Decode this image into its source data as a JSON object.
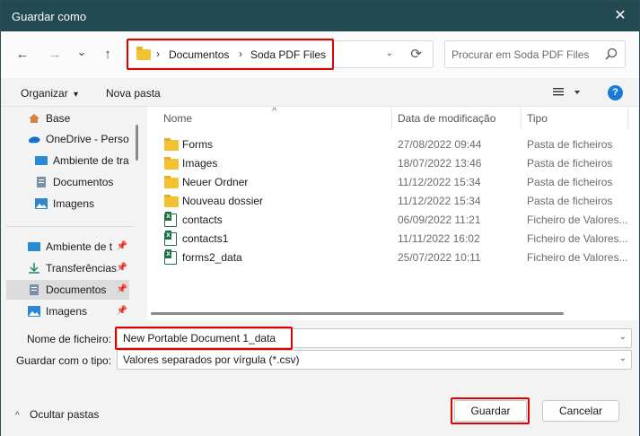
{
  "window": {
    "title": "Guardar como",
    "close_glyph": "✕"
  },
  "nav": {
    "back_glyph": "←",
    "forward_glyph": "→",
    "recent_glyph": "⌄",
    "up_glyph": "↑",
    "address": {
      "separator": "›",
      "crumbs": [
        "Documentos",
        "Soda PDF Files"
      ],
      "dropdown_glyph": "⌄",
      "refresh_glyph": "⟳"
    },
    "search_placeholder": "Procurar em Soda PDF Files"
  },
  "toolbar": {
    "organize_label": "Organizar",
    "organize_chevron": "▾",
    "new_folder_label": "Nova pasta",
    "help_label": "?"
  },
  "sidebar": {
    "items": [
      {
        "label": "Base",
        "icon": "home-icon"
      },
      {
        "label": "OneDrive - Person",
        "icon": "cloud-icon"
      },
      {
        "label": "Ambiente de tra",
        "icon": "desktop-icon"
      },
      {
        "label": "Documentos",
        "icon": "document-icon"
      },
      {
        "label": "Imagens",
        "icon": "image-icon"
      },
      {
        "label": "Ambiente de t",
        "icon": "desktop-icon",
        "pinned": true
      },
      {
        "label": "Transferências",
        "icon": "download-icon",
        "pinned": true
      },
      {
        "label": "Documentos",
        "icon": "document-icon",
        "pinned": true,
        "selected": true
      },
      {
        "label": "Imagens",
        "icon": "image-icon",
        "pinned": true
      }
    ],
    "pin_glyph": "📌"
  },
  "files": {
    "columns": {
      "name": "Nome",
      "date": "Data de modificação",
      "type": "Tipo"
    },
    "sort_glyph": "^",
    "rows": [
      {
        "name": "Forms",
        "date": "27/08/2022 09:44",
        "type": "Pasta de ficheiros",
        "icon": "folder-icon"
      },
      {
        "name": "Images",
        "date": "18/07/2022 13:46",
        "type": "Pasta de ficheiros",
        "icon": "folder-icon"
      },
      {
        "name": "Neuer Ordner",
        "date": "11/12/2022 15:34",
        "type": "Pasta de ficheiros",
        "icon": "folder-icon"
      },
      {
        "name": "Nouveau dossier",
        "date": "11/12/2022 15:34",
        "type": "Pasta de ficheiros",
        "icon": "folder-icon"
      },
      {
        "name": "contacts",
        "date": "06/09/2022 11:21",
        "type": "Ficheiro de Valores...",
        "icon": "excel-icon"
      },
      {
        "name": "contacts1",
        "date": "11/11/2022 16:02",
        "type": "Ficheiro de Valores...",
        "icon": "excel-icon"
      },
      {
        "name": "forms2_data",
        "date": "25/07/2022 10:11",
        "type": "Ficheiro de Valores...",
        "icon": "excel-icon"
      }
    ]
  },
  "form": {
    "filename_label": "Nome de ficheiro:",
    "filename_value": "New Portable Document 1_data",
    "filetype_label": "Guardar com o tipo:",
    "filetype_value": "Valores separados por vírgula (*.csv)",
    "chevron": "⌄"
  },
  "footer": {
    "hide_folders_label": "Ocultar pastas",
    "hide_chevron": "^",
    "save_label": "Guardar",
    "cancel_label": "Cancelar"
  },
  "colors": {
    "titlebar": "#234a52",
    "highlight": "#e00000",
    "accent": "#1a7bd6"
  }
}
